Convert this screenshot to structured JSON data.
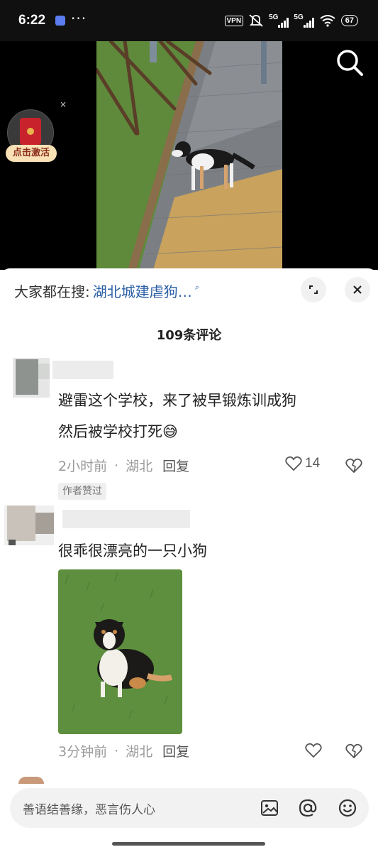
{
  "status_bar": {
    "time": "6:22",
    "vpn": "VPN",
    "net1": "5G",
    "net2": "5G",
    "battery": "67"
  },
  "promo": {
    "label": "点击激活",
    "close": "×"
  },
  "sheet": {
    "search_prefix": "大家都在搜:",
    "search_term": "湖北城建虐狗…",
    "comment_count": "109条评论"
  },
  "comments": [
    {
      "line1": "避雷这个学校，来了被早锻炼训成狗",
      "line2": "然后被学校打死😅",
      "time": "2小时前",
      "location": "湖北",
      "reply": "回复",
      "likes": "14",
      "badge": "作者赞过"
    },
    {
      "line1": "很乖很漂亮的一只小狗",
      "time": "3分钟前",
      "location": "湖北",
      "reply": "回复",
      "likes": ""
    }
  ],
  "input": {
    "placeholder": "善语结善缘，恶言伤人心"
  },
  "icons": {
    "search": "search-icon",
    "expand": "expand-icon",
    "close": "close-icon",
    "heart": "heart-icon",
    "dislike": "broken-heart-icon",
    "image": "image-icon",
    "mention": "at-icon",
    "emoji": "emoji-icon"
  },
  "colors": {
    "link": "#2a5fa6",
    "meta": "#9a9a9a",
    "background_top": "#000000"
  }
}
